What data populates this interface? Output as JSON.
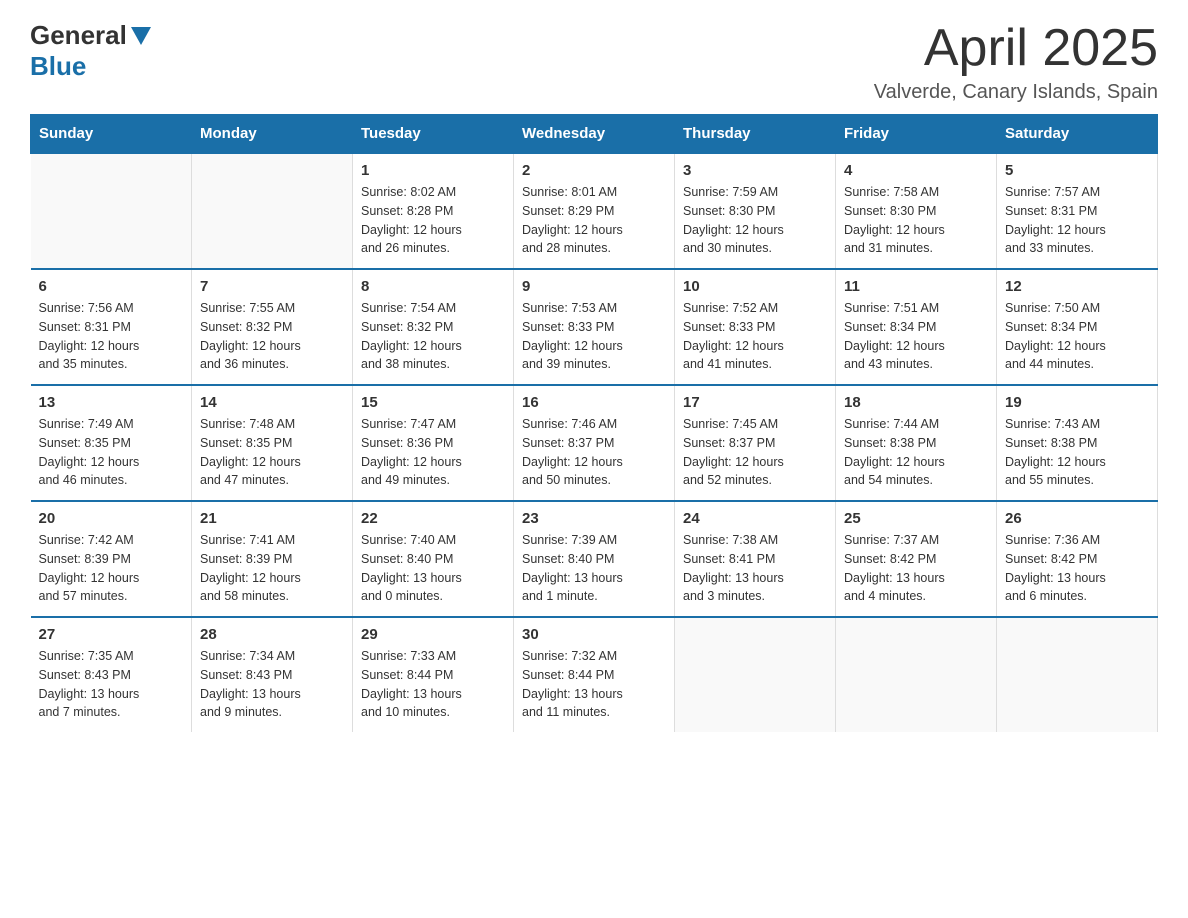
{
  "header": {
    "logo_general": "General",
    "logo_blue": "Blue",
    "month_year": "April 2025",
    "location": "Valverde, Canary Islands, Spain"
  },
  "weekdays": [
    "Sunday",
    "Monday",
    "Tuesday",
    "Wednesday",
    "Thursday",
    "Friday",
    "Saturday"
  ],
  "weeks": [
    [
      {
        "day": "",
        "info": ""
      },
      {
        "day": "",
        "info": ""
      },
      {
        "day": "1",
        "info": "Sunrise: 8:02 AM\nSunset: 8:28 PM\nDaylight: 12 hours\nand 26 minutes."
      },
      {
        "day": "2",
        "info": "Sunrise: 8:01 AM\nSunset: 8:29 PM\nDaylight: 12 hours\nand 28 minutes."
      },
      {
        "day": "3",
        "info": "Sunrise: 7:59 AM\nSunset: 8:30 PM\nDaylight: 12 hours\nand 30 minutes."
      },
      {
        "day": "4",
        "info": "Sunrise: 7:58 AM\nSunset: 8:30 PM\nDaylight: 12 hours\nand 31 minutes."
      },
      {
        "day": "5",
        "info": "Sunrise: 7:57 AM\nSunset: 8:31 PM\nDaylight: 12 hours\nand 33 minutes."
      }
    ],
    [
      {
        "day": "6",
        "info": "Sunrise: 7:56 AM\nSunset: 8:31 PM\nDaylight: 12 hours\nand 35 minutes."
      },
      {
        "day": "7",
        "info": "Sunrise: 7:55 AM\nSunset: 8:32 PM\nDaylight: 12 hours\nand 36 minutes."
      },
      {
        "day": "8",
        "info": "Sunrise: 7:54 AM\nSunset: 8:32 PM\nDaylight: 12 hours\nand 38 minutes."
      },
      {
        "day": "9",
        "info": "Sunrise: 7:53 AM\nSunset: 8:33 PM\nDaylight: 12 hours\nand 39 minutes."
      },
      {
        "day": "10",
        "info": "Sunrise: 7:52 AM\nSunset: 8:33 PM\nDaylight: 12 hours\nand 41 minutes."
      },
      {
        "day": "11",
        "info": "Sunrise: 7:51 AM\nSunset: 8:34 PM\nDaylight: 12 hours\nand 43 minutes."
      },
      {
        "day": "12",
        "info": "Sunrise: 7:50 AM\nSunset: 8:34 PM\nDaylight: 12 hours\nand 44 minutes."
      }
    ],
    [
      {
        "day": "13",
        "info": "Sunrise: 7:49 AM\nSunset: 8:35 PM\nDaylight: 12 hours\nand 46 minutes."
      },
      {
        "day": "14",
        "info": "Sunrise: 7:48 AM\nSunset: 8:35 PM\nDaylight: 12 hours\nand 47 minutes."
      },
      {
        "day": "15",
        "info": "Sunrise: 7:47 AM\nSunset: 8:36 PM\nDaylight: 12 hours\nand 49 minutes."
      },
      {
        "day": "16",
        "info": "Sunrise: 7:46 AM\nSunset: 8:37 PM\nDaylight: 12 hours\nand 50 minutes."
      },
      {
        "day": "17",
        "info": "Sunrise: 7:45 AM\nSunset: 8:37 PM\nDaylight: 12 hours\nand 52 minutes."
      },
      {
        "day": "18",
        "info": "Sunrise: 7:44 AM\nSunset: 8:38 PM\nDaylight: 12 hours\nand 54 minutes."
      },
      {
        "day": "19",
        "info": "Sunrise: 7:43 AM\nSunset: 8:38 PM\nDaylight: 12 hours\nand 55 minutes."
      }
    ],
    [
      {
        "day": "20",
        "info": "Sunrise: 7:42 AM\nSunset: 8:39 PM\nDaylight: 12 hours\nand 57 minutes."
      },
      {
        "day": "21",
        "info": "Sunrise: 7:41 AM\nSunset: 8:39 PM\nDaylight: 12 hours\nand 58 minutes."
      },
      {
        "day": "22",
        "info": "Sunrise: 7:40 AM\nSunset: 8:40 PM\nDaylight: 13 hours\nand 0 minutes."
      },
      {
        "day": "23",
        "info": "Sunrise: 7:39 AM\nSunset: 8:40 PM\nDaylight: 13 hours\nand 1 minute."
      },
      {
        "day": "24",
        "info": "Sunrise: 7:38 AM\nSunset: 8:41 PM\nDaylight: 13 hours\nand 3 minutes."
      },
      {
        "day": "25",
        "info": "Sunrise: 7:37 AM\nSunset: 8:42 PM\nDaylight: 13 hours\nand 4 minutes."
      },
      {
        "day": "26",
        "info": "Sunrise: 7:36 AM\nSunset: 8:42 PM\nDaylight: 13 hours\nand 6 minutes."
      }
    ],
    [
      {
        "day": "27",
        "info": "Sunrise: 7:35 AM\nSunset: 8:43 PM\nDaylight: 13 hours\nand 7 minutes."
      },
      {
        "day": "28",
        "info": "Sunrise: 7:34 AM\nSunset: 8:43 PM\nDaylight: 13 hours\nand 9 minutes."
      },
      {
        "day": "29",
        "info": "Sunrise: 7:33 AM\nSunset: 8:44 PM\nDaylight: 13 hours\nand 10 minutes."
      },
      {
        "day": "30",
        "info": "Sunrise: 7:32 AM\nSunset: 8:44 PM\nDaylight: 13 hours\nand 11 minutes."
      },
      {
        "day": "",
        "info": ""
      },
      {
        "day": "",
        "info": ""
      },
      {
        "day": "",
        "info": ""
      }
    ]
  ]
}
